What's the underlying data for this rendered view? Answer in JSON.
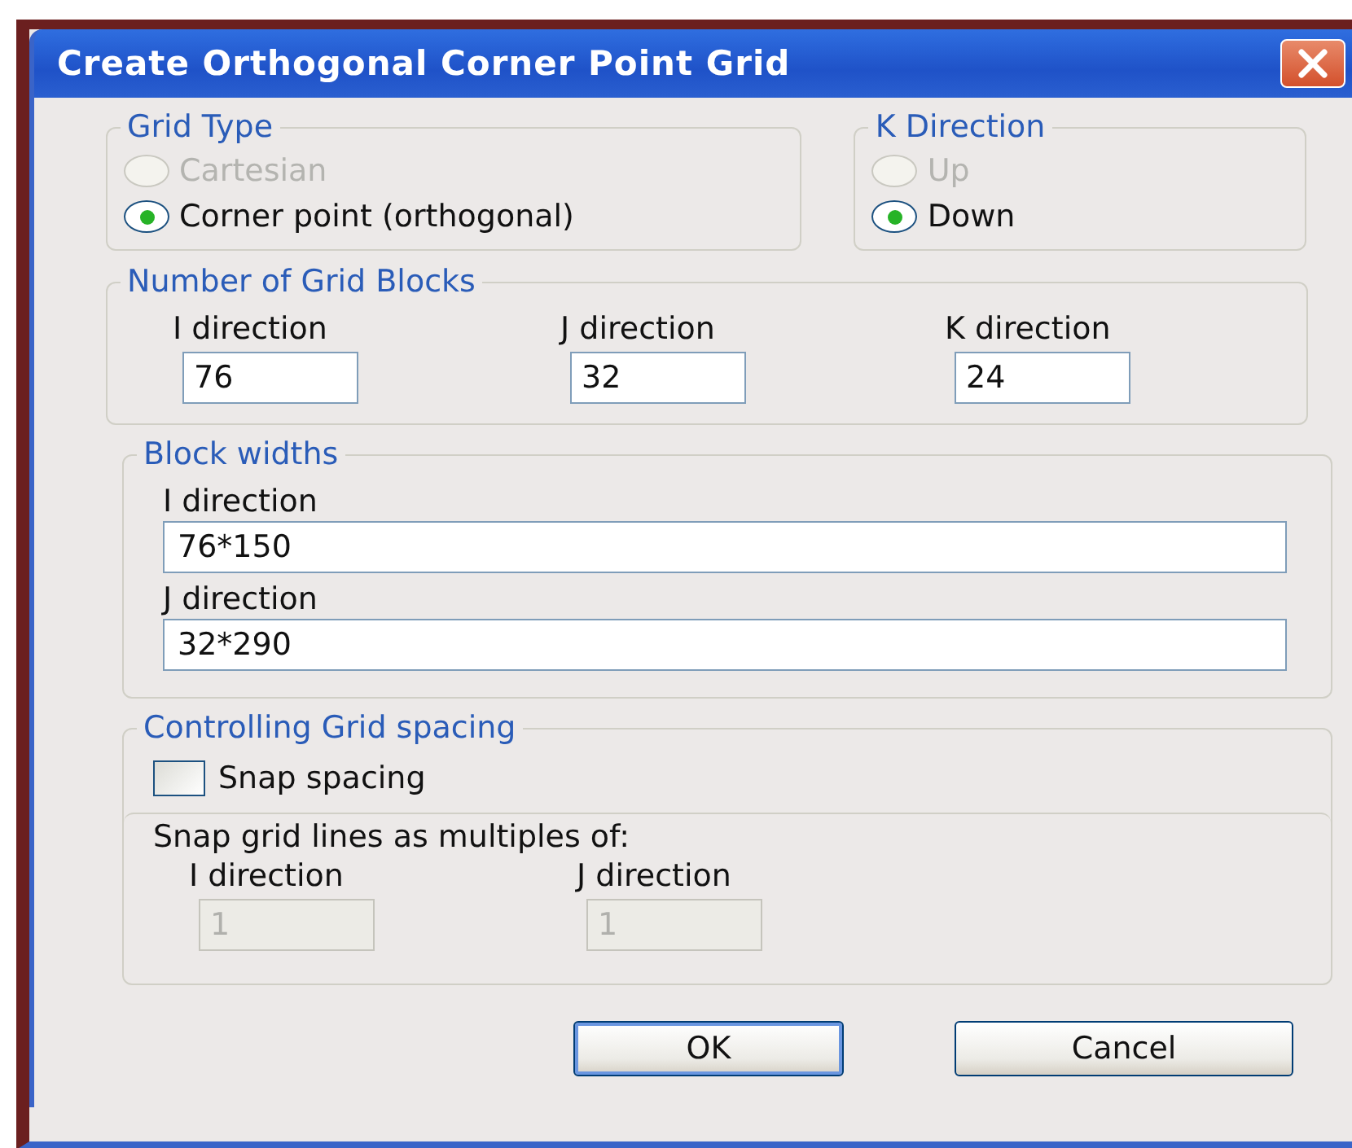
{
  "window": {
    "title": "Create Orthogonal Corner Point Grid"
  },
  "grid_type": {
    "label": "Grid Type",
    "options": [
      {
        "label": "Cartesian",
        "selected": false,
        "disabled": true
      },
      {
        "label": "Corner point (orthogonal)",
        "selected": true,
        "disabled": false
      }
    ]
  },
  "k_direction": {
    "label": "K Direction",
    "options": [
      {
        "label": "Up",
        "selected": false,
        "disabled": true
      },
      {
        "label": "Down",
        "selected": true,
        "disabled": false
      }
    ]
  },
  "grid_blocks": {
    "label": "Number of Grid Blocks",
    "fields": [
      {
        "label": "I direction",
        "value": "76"
      },
      {
        "label": "J direction",
        "value": "32"
      },
      {
        "label": "K direction",
        "value": "24"
      }
    ]
  },
  "block_widths": {
    "label": "Block widths",
    "fields": [
      {
        "label": "I direction",
        "value": "76*150"
      },
      {
        "label": "J direction",
        "value": "32*290"
      }
    ]
  },
  "controlling": {
    "label": "Controlling Grid spacing",
    "snap": {
      "label": "Snap spacing",
      "checked": false
    },
    "multiples": {
      "label": "Snap grid lines as multiples of:",
      "fields": [
        {
          "label": "I direction",
          "value": "1",
          "disabled": true
        },
        {
          "label": "J direction",
          "value": "1",
          "disabled": true
        }
      ]
    }
  },
  "buttons": [
    {
      "label": "OK",
      "default": true
    },
    {
      "label": "Cancel",
      "default": false
    }
  ]
}
